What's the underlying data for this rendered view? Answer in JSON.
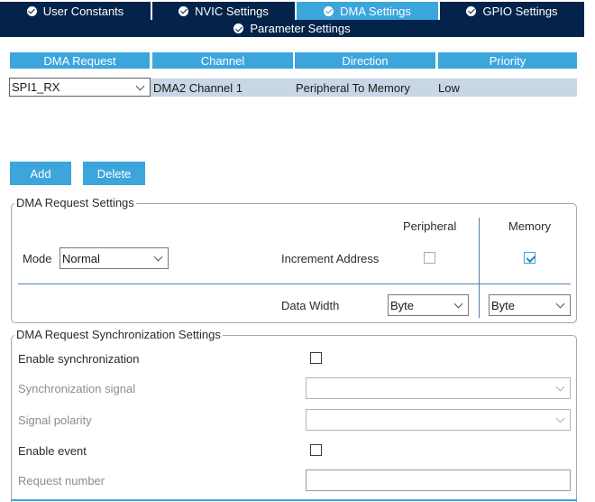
{
  "tabs": [
    {
      "label": "User Constants",
      "active": false
    },
    {
      "label": "NVIC Settings",
      "active": false
    },
    {
      "label": "DMA Settings",
      "active": true
    },
    {
      "label": "GPIO Settings",
      "active": false
    }
  ],
  "parameter_settings_label": "Parameter Settings",
  "table": {
    "headers": [
      "DMA Request",
      "Channel",
      "Direction",
      "Priority"
    ],
    "rows": [
      {
        "request": "SPI1_RX",
        "channel": "DMA2 Channel 1",
        "direction": "Peripheral To Memory",
        "priority": "Low"
      }
    ]
  },
  "buttons": {
    "add": "Add",
    "delete": "Delete"
  },
  "request_settings": {
    "legend": "DMA Request Settings",
    "peripheral_header": "Peripheral",
    "memory_header": "Memory",
    "mode_label": "Mode",
    "mode_value": "Normal",
    "increment_label": "Increment Address",
    "peripheral_increment": false,
    "memory_increment": true,
    "data_width_label": "Data Width",
    "peripheral_width": "Byte",
    "memory_width": "Byte"
  },
  "sync_settings": {
    "legend": "DMA Request Synchronization Settings",
    "enable_sync_label": "Enable synchronization",
    "enable_sync_checked": false,
    "sync_signal_label": "Synchronization signal",
    "sync_signal_value": "",
    "signal_polarity_label": "Signal polarity",
    "signal_polarity_value": "",
    "enable_event_label": "Enable event",
    "enable_event_checked": false,
    "request_number_label": "Request number",
    "request_number_value": ""
  },
  "colors": {
    "navy": "#03234b",
    "accent": "#3ca5dc",
    "row_selected": "#c8d6e5"
  },
  "icons": [
    "check-circle-icon",
    "chevron-down-icon",
    "checkbox-icon"
  ]
}
